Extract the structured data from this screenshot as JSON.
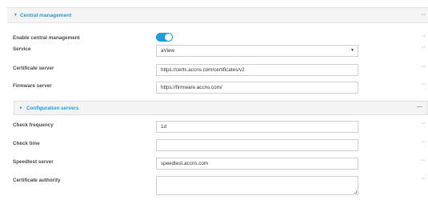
{
  "section": {
    "title": "Central management",
    "collapsed": false
  },
  "fields": {
    "enable_central_management": {
      "label": "Enable central management",
      "enabled": true
    },
    "service": {
      "label": "Service",
      "value": "aView"
    },
    "certificate_server": {
      "label": "Certificate server",
      "value": "https://certs.accns.com/certificates/v2"
    },
    "firmware_server": {
      "label": "Firmware server",
      "value": "https://firmware.accns.com/"
    }
  },
  "subsection": {
    "title": "Configuration servers",
    "collapsed": true
  },
  "sub_fields": {
    "check_frequency": {
      "label": "Check frequency",
      "value": "1d"
    },
    "check_time": {
      "label": "Check time",
      "value": ""
    },
    "speedtest_server": {
      "label": "Speedtest server",
      "value": "speedtest.accns.com"
    },
    "certificate_authority": {
      "label": "Certificate authority",
      "value": ""
    }
  },
  "icons": {
    "expanded": "triangle-down-icon",
    "collapsed": "triangle-right-icon",
    "row_menu": "more-dots-icon",
    "collapse": "minus-icon"
  },
  "colors": {
    "accent": "#1e9fd6",
    "header_bg": "#f4f4f4"
  }
}
